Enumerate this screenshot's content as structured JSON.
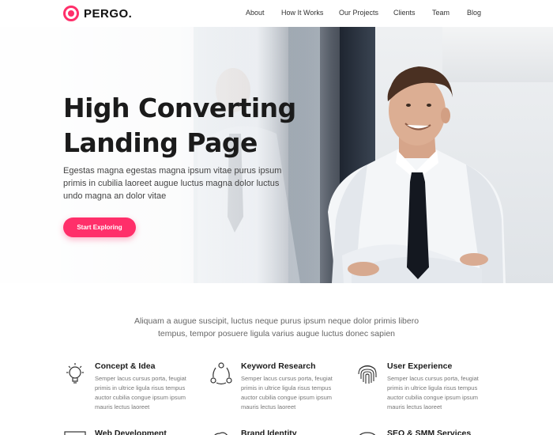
{
  "brand": {
    "name": "PERGO.",
    "accent": "#ff2f6a"
  },
  "nav": [
    {
      "label": "About"
    },
    {
      "label": "How It Works"
    },
    {
      "label": "Our Projects"
    },
    {
      "label": "Clients"
    },
    {
      "label": "Team"
    },
    {
      "label": "Blog"
    }
  ],
  "hero": {
    "title_line1": "High Converting",
    "title_line2": "Landing Page",
    "subtitle": "Egestas magna egestas magna ipsum vitae purus ipsum primis in cubilia laoreet augue luctus magna dolor luctus undo magna an dolor vitae",
    "cta_label": "Start Exploring"
  },
  "intro": {
    "text": "Aliquam a augue suscipit, luctus neque purus ipsum neque dolor primis libero tempus, tempor posuere ligula varius augue luctus donec sapien"
  },
  "features": [
    {
      "title": "Concept & Idea",
      "text": "Semper lacus cursus porta, feugiat primis in ultrice ligula risus tempus auctor cubilia congue ipsum ipsum mauris lectus laoreet",
      "icon": "lightbulb-icon"
    },
    {
      "title": "Keyword Research",
      "text": "Semper lacus cursus porta, feugiat primis in ultrice ligula risus tempus auctor cubilia congue ipsum ipsum mauris lectus laoreet",
      "icon": "network-icon"
    },
    {
      "title": "User Experience",
      "text": "Semper lacus cursus porta, feugiat primis in ultrice ligula risus tempus auctor cubilia congue ipsum ipsum mauris lectus laoreet",
      "icon": "fingerprint-icon"
    },
    {
      "title": "Web Development",
      "text": "",
      "icon": "code-window-icon"
    },
    {
      "title": "Brand Identity",
      "text": "",
      "icon": "cloud-icon"
    },
    {
      "title": "SEO & SMM Services",
      "text": "",
      "icon": "speedometer-icon"
    }
  ]
}
